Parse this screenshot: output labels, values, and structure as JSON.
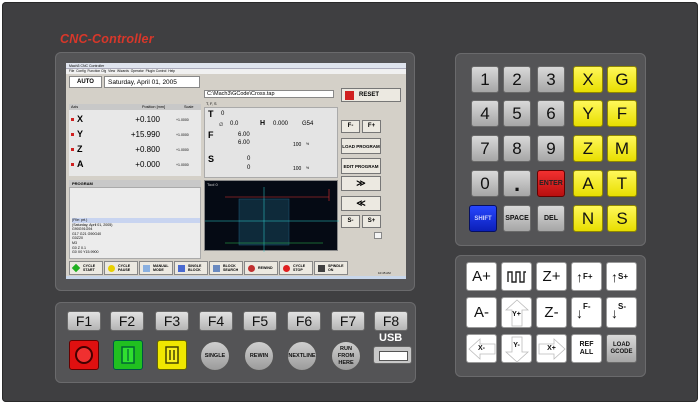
{
  "brand": "CNC-Controller",
  "screen": {
    "title_bar": "Mach3 CNC Controller",
    "menu": [
      "File",
      "Config",
      "Function Cfg",
      "View",
      "Wizards",
      "Operator",
      "Plugin Control",
      "Help"
    ],
    "mode": "AUTO",
    "date": "Saturday, April 01, 2005",
    "file_path": "C:\\Mach3\\GCode\\Cross.tap",
    "reset_label": "RESET",
    "axes_header": {
      "axis": "Axis",
      "position": "Position [mm]",
      "scale": "Scale"
    },
    "axes": [
      {
        "name": "X",
        "value": "+0.100",
        "scale": "+1.0000"
      },
      {
        "name": "Y",
        "value": "+15.990",
        "scale": "+1.0000"
      },
      {
        "name": "Z",
        "value": "+0.800",
        "scale": "+1.0000"
      },
      {
        "name": "A",
        "value": "+0.000",
        "scale": "+1.0000"
      }
    ],
    "tfs_label": "T, F, S",
    "t_label": "T",
    "t_value": "0",
    "diam_value": "0.0",
    "h_label": "H",
    "h_value": "0.000",
    "g54": "G54",
    "f_label": "F",
    "f_value1": "6.00",
    "f_value2": "6.00",
    "f_pct": "100",
    "s_label": "S",
    "s_value1": "0",
    "s_value2": "0",
    "s_pct": "100",
    "pct_sign": "%",
    "feed_buttons": [
      "F-",
      "F+"
    ],
    "load_program": "LOAD PROGRAM",
    "edit_program": "EDIT PROGRAM",
    "spindle_buttons": [
      "S-",
      "S+"
    ],
    "program_header": "PROGRAM",
    "program_lines": [
      "(File: prt.)",
      "(Saturday, April 01, 2005)",
      "G90G91G94",
      "G17 G21 G90G40",
      "G0Z20",
      "M3",
      "G0 Z 0.1",
      "G0 X0 Y15.9900"
    ],
    "toolpath_label": "Tool 0",
    "bottom_buttons": [
      "CYCLE START",
      "CYCLE PAUSE",
      "MANUAL MODE",
      "SINGLE BLOCK",
      "BLOCK SEARCH",
      "REWIND",
      "CYCLE STOP",
      "SPINDLE ON"
    ],
    "taskbar_time": "10:45 AM"
  },
  "numpad": [
    [
      "1",
      "2",
      "3",
      "X",
      "G"
    ],
    [
      "4",
      "5",
      "6",
      "Y",
      "F"
    ],
    [
      "7",
      "8",
      "9",
      "Z",
      "M"
    ],
    [
      "0",
      ".",
      "ENTER",
      "A",
      "T"
    ],
    [
      "SHIFT",
      "SPACE",
      "DEL",
      "N",
      "S"
    ]
  ],
  "jog": {
    "row1": [
      "A+",
      "",
      "Z+",
      "F+",
      "S+"
    ],
    "row2": [
      "A-",
      "Y+",
      "Z-",
      "F-",
      "S-"
    ],
    "row3": [
      "X-",
      "Y-",
      "X+",
      "REF ALL",
      "LOAD GCODE"
    ]
  },
  "fkeys": [
    "F1",
    "F2",
    "F3",
    "F4",
    "F5",
    "F6",
    "F7",
    "F8"
  ],
  "round_buttons": [
    "SINGLE",
    "REWIN",
    "NEXTLINE",
    "RUN FROM HERE"
  ],
  "usb_label": "USB"
}
